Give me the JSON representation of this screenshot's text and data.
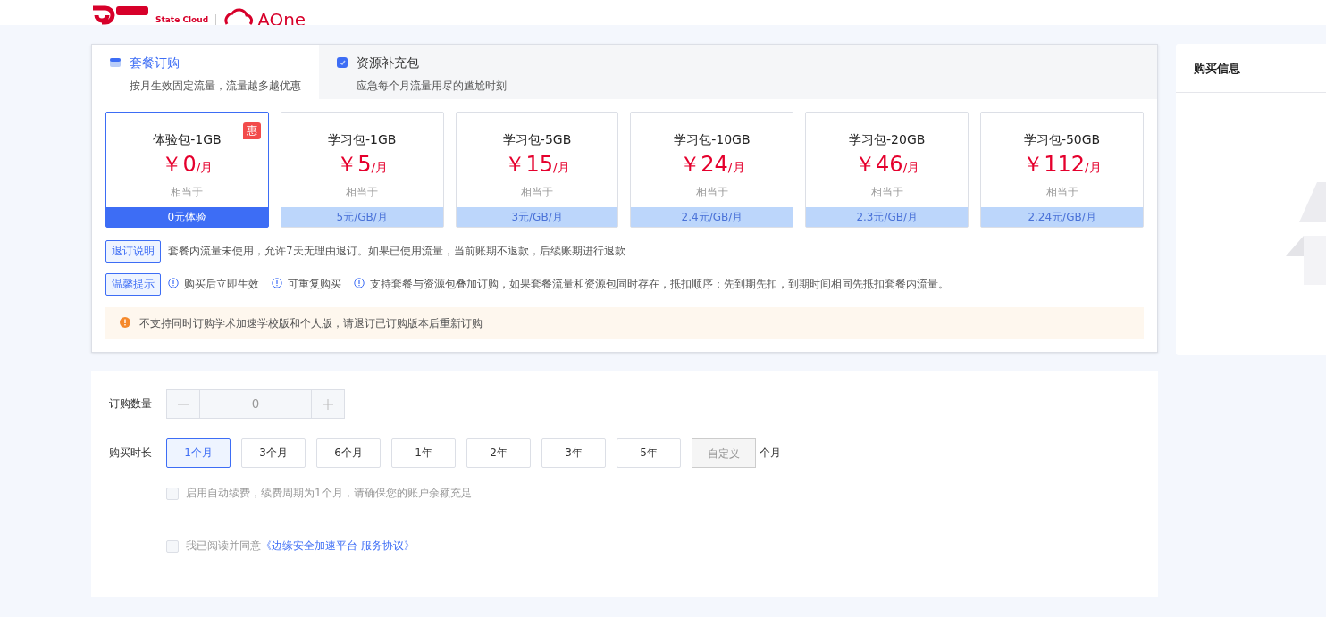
{
  "header": {
    "brand_sub": "State Cloud",
    "product": "AOne"
  },
  "tabs": [
    {
      "title": "套餐订购",
      "desc": "按月生效固定流量，流量越多越优惠",
      "selected": true
    },
    {
      "title": "资源补充包",
      "desc": "应急每个月流量用尽的尴尬时刻",
      "selected": false
    }
  ],
  "packages": [
    {
      "name": "体验包-1GB",
      "price": "￥0",
      "unit": "/月",
      "equiv": "相当于",
      "rate": "0元体验",
      "badge": "惠",
      "selected": true
    },
    {
      "name": "学习包-1GB",
      "price": "￥5",
      "unit": "/月",
      "equiv": "相当于",
      "rate": "5元/GB/月",
      "selected": false
    },
    {
      "name": "学习包-5GB",
      "price": "￥15",
      "unit": "/月",
      "equiv": "相当于",
      "rate": "3元/GB/月",
      "selected": false
    },
    {
      "name": "学习包-10GB",
      "price": "￥24",
      "unit": "/月",
      "equiv": "相当于",
      "rate": "2.4元/GB/月",
      "selected": false
    },
    {
      "name": "学习包-20GB",
      "price": "￥46",
      "unit": "/月",
      "equiv": "相当于",
      "rate": "2.3元/GB/月",
      "selected": false
    },
    {
      "name": "学习包-50GB",
      "price": "￥112",
      "unit": "/月",
      "equiv": "相当于",
      "rate": "2.24元/GB/月",
      "selected": false
    }
  ],
  "refund": {
    "tag": "退订说明",
    "text": "套餐内流量未使用，允许7天无理由退订。如果已使用流量，当前账期不退款，后续账期进行退款"
  },
  "tips": {
    "tag": "温馨提示",
    "items": [
      "购买后立即生效",
      "可重复购买",
      "支持套餐与资源包叠加订购，如果套餐流量和资源包同时存在，抵扣顺序：先到期先扣，到期时间相同先抵扣套餐内流量。"
    ]
  },
  "warning": "不支持同时订购学术加速学校版和个人版，请退订已订购版本后重新订购",
  "quantity": {
    "label": "订购数量",
    "value": "0",
    "disabled": true
  },
  "duration": {
    "label": "购买时长",
    "options": [
      {
        "label": "1个月",
        "selected": true
      },
      {
        "label": "3个月",
        "selected": false
      },
      {
        "label": "6个月",
        "selected": false
      },
      {
        "label": "1年",
        "selected": false
      },
      {
        "label": "2年",
        "selected": false
      },
      {
        "label": "3年",
        "selected": false
      },
      {
        "label": "5年",
        "selected": false
      }
    ],
    "custom": {
      "placeholder": "自定义",
      "suffix": "个月"
    }
  },
  "auto_renew": {
    "text": "启用自动续费，续费周期为1个月，请确保您的账户余额充足",
    "checked": false
  },
  "agreement": {
    "text": "我已阅读并同意",
    "link": "《边缘安全加速平台-服务协议》",
    "checked": false
  },
  "purchase_info": {
    "title": "购买信息"
  }
}
